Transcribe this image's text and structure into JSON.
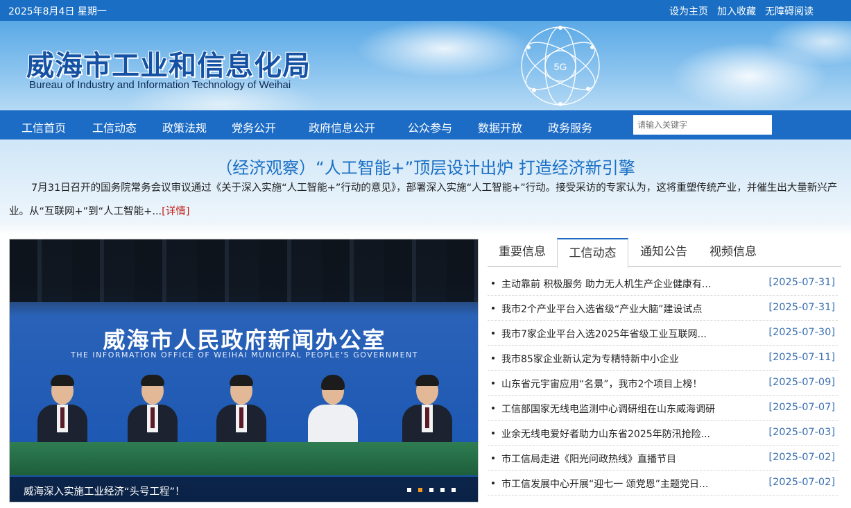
{
  "topbar": {
    "date": "2025年8月4日 星期一",
    "links": [
      "设为主页",
      "加入收藏",
      "无障碍阅读"
    ]
  },
  "header": {
    "title": "威海市工业和信息化局",
    "subtitle": "Bureau of Industry and Information Technology of Weihai",
    "emblem_label": "5G"
  },
  "nav": {
    "items": [
      "工信首页",
      "工信动态",
      "政策法规",
      "党务公开",
      "政府信息公开",
      "公众参与",
      "数据开放",
      "政务服务"
    ],
    "search_placeholder": "请输入关键字"
  },
  "headline": {
    "title": "（经济观察）“人工智能+”顶层设计出炉 打造经济新引擎",
    "summary": "7月31日召开的国务院常务会议审议通过《关于深入实施“人工智能+”行动的意见》，部署深入实施“人工智能+”行动。接受采访的专家认为，这将重塑传统产业，并催生出大量新兴产业。从“互联网+”到“人工智能+...",
    "detail_link": "[详情]"
  },
  "slideshow": {
    "backdrop_cn": "威海市人民政府新闻办公室",
    "backdrop_en": "THE INFORMATION OFFICE OF WEIHAI MUNICIPAL PEOPLE'S GOVERNMENT",
    "caption": "威海深入实施工业经济“头号工程”！",
    "slide_count": 5,
    "active_index": 1
  },
  "news": {
    "tabs": [
      "重要信息",
      "工信动态",
      "通知公告",
      "视频信息"
    ],
    "active_tab": 1,
    "items": [
      {
        "title": "主动靠前 积极服务 助力无人机生产企业健康有...",
        "date": "[2025-07-31]"
      },
      {
        "title": "我市2个产业平台入选省级“产业大脑”建设试点",
        "date": "[2025-07-31]"
      },
      {
        "title": "我市7家企业平台入选2025年省级工业互联网...",
        "date": "[2025-07-30]"
      },
      {
        "title": "我市85家企业新认定为专精特新中小企业",
        "date": "[2025-07-11]"
      },
      {
        "title": "山东省元宇宙应用“名景”，我市2个项目上榜！",
        "date": "[2025-07-09]"
      },
      {
        "title": "工信部国家无线电监测中心调研组在山东威海调研",
        "date": "[2025-07-07]"
      },
      {
        "title": "业余无线电爱好者助力山东省2025年防汛抢险...",
        "date": "[2025-07-03]"
      },
      {
        "title": "市工信局走进《阳光问政热线》直播节目",
        "date": "[2025-07-02]"
      },
      {
        "title": "市工信发展中心开展“迎七一 颂党恩”主题党日...",
        "date": "[2025-07-02]"
      }
    ]
  },
  "colors": {
    "primary": "#1c6cc6",
    "accent": "#f39a1e",
    "link_red": "#c0221a",
    "date_blue": "#3a6fb0"
  }
}
